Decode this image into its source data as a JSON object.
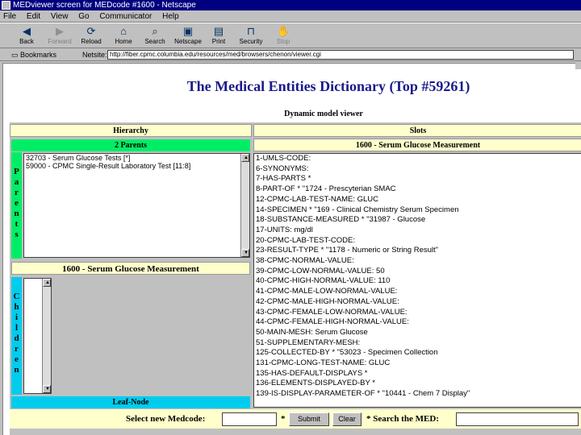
{
  "window": {
    "title": "MEDviewer screen for MEDcode #1600 - Netscape"
  },
  "menu": [
    "File",
    "Edit",
    "View",
    "Go",
    "Communicator",
    "Help"
  ],
  "toolbar": {
    "back": "Back",
    "forward": "Forward",
    "reload": "Reload",
    "home": "Home",
    "search": "Search",
    "netscape": "Netscape",
    "print": "Print",
    "security": "Security",
    "stop": "Stop"
  },
  "location": {
    "bookmarks": "Bookmarks",
    "netsite_label": "Netsite:",
    "url": "http://fiber.cpmc.columbia.edu/resources/med/browsers/chenon/viewer.cgi"
  },
  "page": {
    "title": "The Medical Entities Dictionary (Top #59261)",
    "subtitle": "Dynamic model viewer"
  },
  "hierarchy": {
    "header": "Hierarchy",
    "parents_label": "2 Parents",
    "parents_vertical": [
      "P",
      "a",
      "r",
      "e",
      "n",
      "t",
      "s"
    ],
    "parents": [
      "32703 - Serum Glucose Tests [*]",
      "59000 - CPMC Single-Result Laboratory Test [11:8]"
    ],
    "current": "1600 - Serum Glucose Measurement",
    "children_vertical": [
      "C",
      "h",
      "i",
      "l",
      "d",
      "r",
      "e",
      "n"
    ],
    "children": [
      ""
    ],
    "leaf": "Leaf-Node"
  },
  "slots": {
    "header": "Slots",
    "concept": "1600 - Serum Glucose Measurement",
    "items": [
      "1-UMLS-CODE:",
      "6-SYNONYMS:",
      "7-HAS-PARTS *",
      "8-PART-OF * \"1724 - Prescyterian SMAC",
      "12-CPMC-LAB-TEST-NAME: GLUC",
      "14-SPECIMEN * \"169 - Clinical Chemistry Serum Specimen",
      "18-SUBSTANCE-MEASURED * \"31987 - Glucose",
      "17-UNITS: mg/dl",
      "20-CPMC-LAB-TEST-CODE:",
      "23-RESULT-TYPE * \"1178 - Numeric or String Result\"",
      "38-CPMC-NORMAL-VALUE:",
      "39-CPMC-LOW-NORMAL-VALUE: 50",
      "40-CPMC-HIGH-NORMAL-VALUE: 110",
      "41-CPMC-MALE-LOW-NORMAL-VALUE:",
      "42-CPMC-MALE-HIGH-NORMAL-VALUE:",
      "43-CPMC-FEMALE-LOW-NORMAL-VALUE:",
      "44-CPMC-FEMALE-HIGH-NORMAL-VALUE:",
      "50-MAIN-MESH: Serum Glucose",
      "51-SUPPLEMENTARY-MESH:",
      "125-COLLECTED-BY * \"53023 - Specimen Collection",
      "131-CPMC-LONG-TEST-NAME: GLUC",
      "135-HAS-DEFAULT-DISPLAYS *",
      "136-ELEMENTS-DISPLAYED-BY *",
      "139-IS-DISPLAY-PARAMETER-OF * \"10441 - Chem 7 Display\""
    ]
  },
  "form": {
    "select_label": "Select new Medcode:",
    "asterisk": "*",
    "submit": "Submit",
    "clear": "Clear",
    "search_label": "* Search the MED:"
  }
}
